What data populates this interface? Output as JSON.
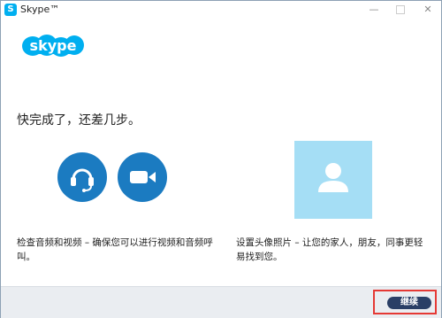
{
  "window": {
    "title": "Skype™",
    "icon_letter": "S"
  },
  "logo": {
    "text": "skype"
  },
  "main": {
    "heading": "快完成了，还差几步。",
    "audio_video_desc": "检查音频和视频 – 确保您可以进行视频和音频呼叫。",
    "profile_photo_desc": "设置头像照片 – 让您的家人，朋友，同事更轻易找到您。"
  },
  "footer": {
    "continue_label": "继续"
  },
  "colors": {
    "brand": "#00aff0",
    "circle_blue": "#1b7bc1",
    "avatar_bg": "#a5def5",
    "continue_bg": "#2a3f66",
    "highlight": "#e53935"
  },
  "icons": {
    "audio": "headset-icon",
    "video": "video-camera-icon",
    "avatar": "person-icon"
  }
}
